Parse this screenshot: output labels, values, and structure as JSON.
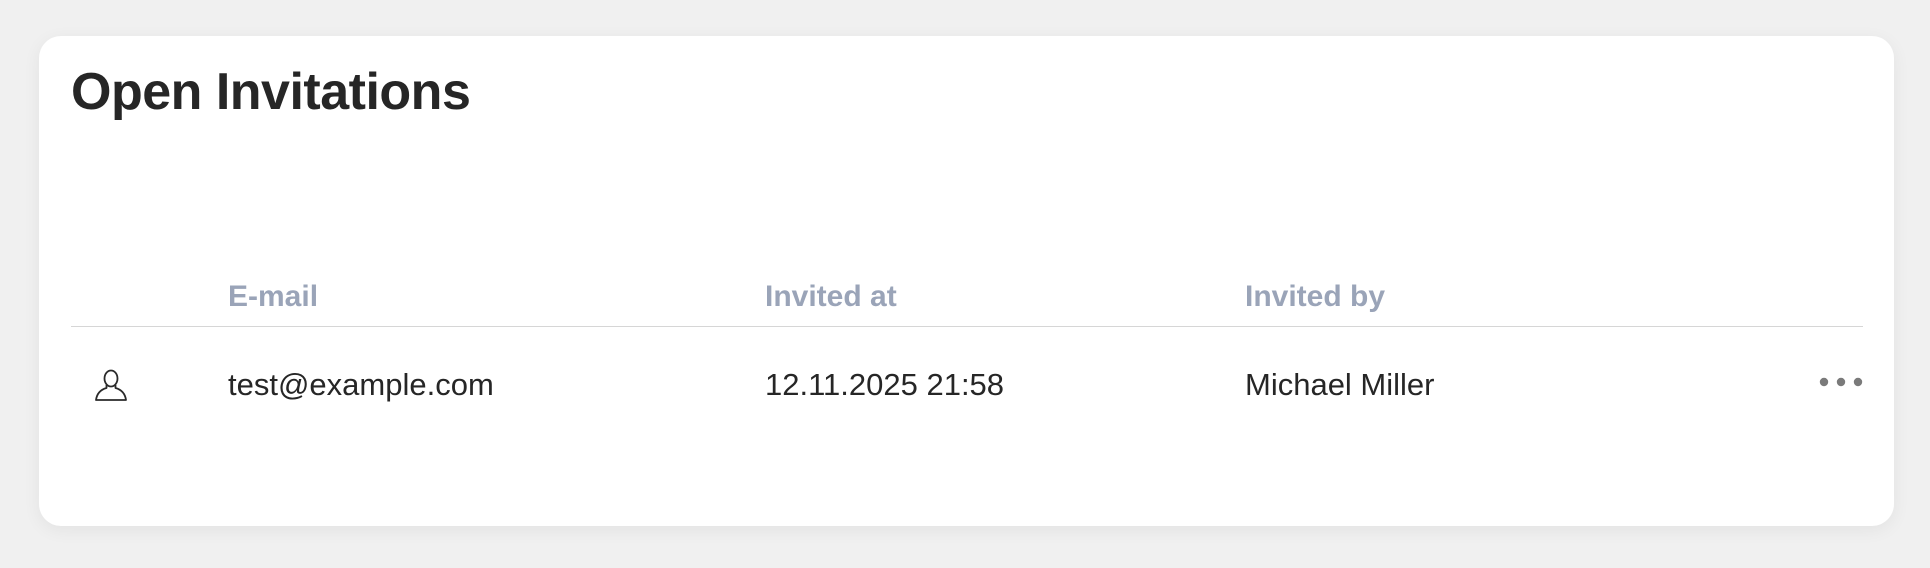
{
  "page": {
    "title": "Open Invitations"
  },
  "table": {
    "columns": {
      "email": "E-mail",
      "invited_at": "Invited at",
      "invited_by": "Invited by"
    },
    "rows": [
      {
        "icon": "user-icon",
        "email": "test@example.com",
        "invited_at": "12.11.2025 21:58",
        "invited_by": "Michael Miller",
        "actions_icon": "more-horizontal-icon"
      }
    ]
  },
  "colors": {
    "background": "#f0f0f0",
    "card": "#ffffff",
    "header_text": "#9aa4b8",
    "body_text": "#262626",
    "divider": "#d6d6d6"
  }
}
